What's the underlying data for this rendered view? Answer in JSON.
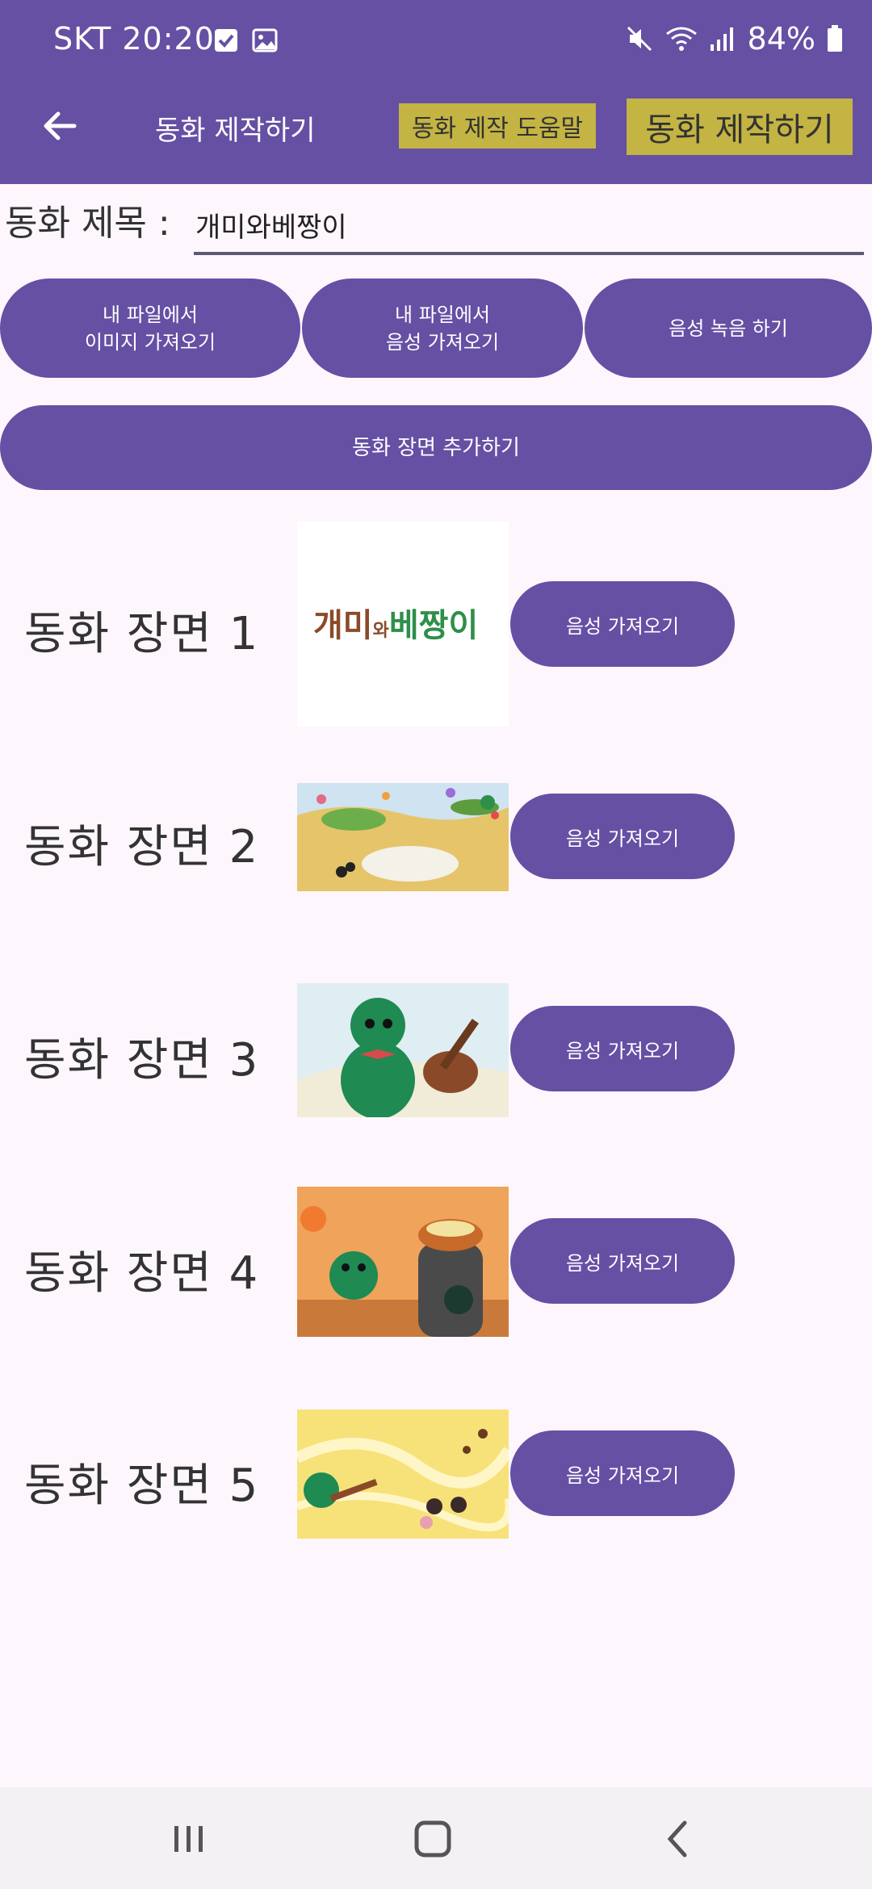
{
  "status_bar": {
    "carrier_time": "SKT 20:20",
    "battery": "84%"
  },
  "app_bar": {
    "title": "동화 제작하기",
    "help_button": "동화 제작 도움말",
    "make_button": "동화 제작하기"
  },
  "title_field": {
    "label": "동화 제목 :",
    "value": "개미와베짱이"
  },
  "actions": {
    "import_image_line1": "내 파일에서",
    "import_image_line2": "이미지 가져오기",
    "import_audio_line1": "내 파일에서",
    "import_audio_line2": "음성 가져오기",
    "record_audio": "음성 녹음 하기",
    "add_scene": "동화 장면 추가하기"
  },
  "scenes": [
    {
      "label": "동화 장면 1",
      "voice_button": "음성 가져오기",
      "cover_text_a": "개미",
      "cover_text_b": "와",
      "cover_text_c": "베짱이"
    },
    {
      "label": "동화 장면 2",
      "voice_button": "음성 가져오기"
    },
    {
      "label": "동화 장면 3",
      "voice_button": "음성 가져오기"
    },
    {
      "label": "동화 장면 4",
      "voice_button": "음성 가져오기"
    },
    {
      "label": "동화 장면 5",
      "voice_button": "음성 가져오기"
    }
  ],
  "colors": {
    "primary": "#6550a4",
    "accent": "#c3b443",
    "background": "#fdf7fd"
  }
}
